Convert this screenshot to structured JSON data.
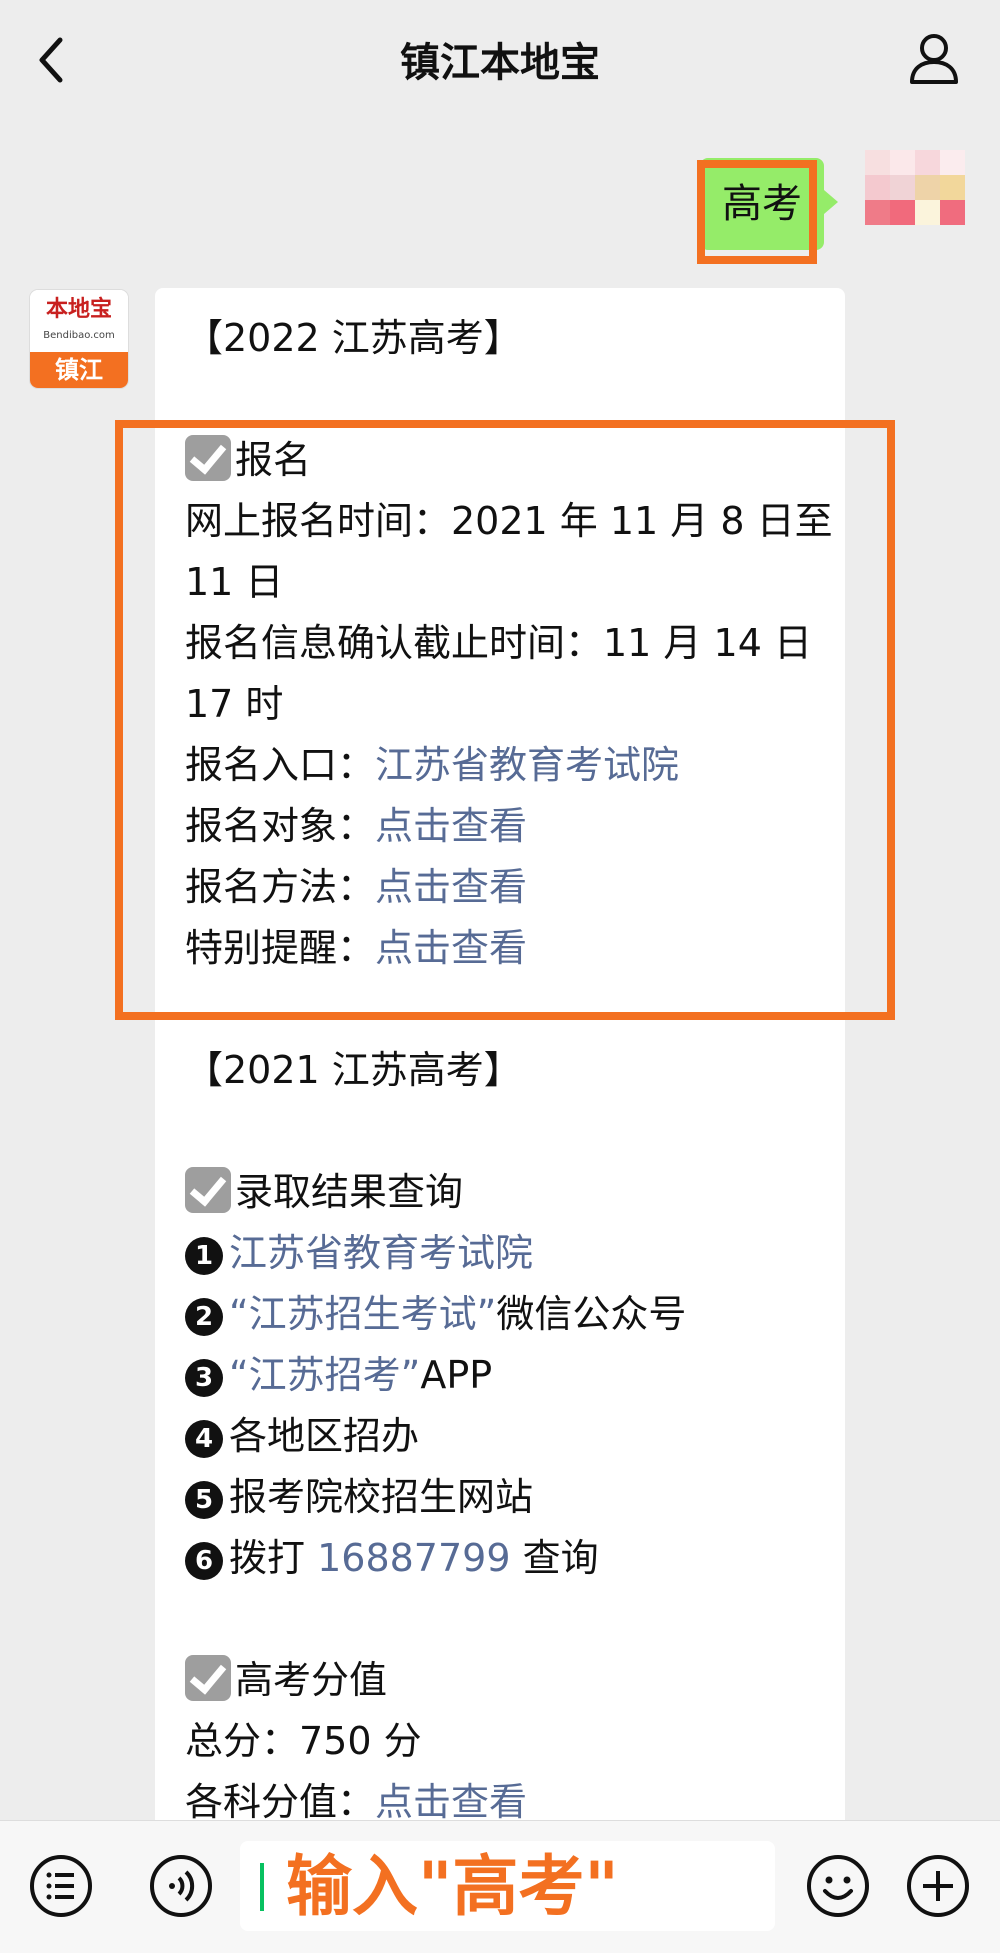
{
  "header": {
    "title": "镇江本地宝"
  },
  "outgoing_message": {
    "text": "高考"
  },
  "bot_avatar": {
    "brand": "本地宝",
    "brand_sub": "Bendibao.com",
    "city": "镇江"
  },
  "reply": {
    "section_2022": {
      "heading": "【2022 江苏高考】",
      "registration_title": "报名",
      "online_time_line1": "网上报名时间：2021 年 11 月 8 日至",
      "online_time_line2": "11 日",
      "confirm_line1": "报名信息确认截止时间：11 月 14 日",
      "confirm_line2": "17 时",
      "entry_label": "报名入口：",
      "entry_link": "江苏省教育考试院",
      "target_label": "报名对象：",
      "target_link": "点击查看",
      "method_label": "报名方法：",
      "method_link": "点击查看",
      "reminder_label": "特别提醒：",
      "reminder_link": "点击查看"
    },
    "section_2021": {
      "heading": "【2021 江苏高考】",
      "admission_title": "录取结果查询",
      "items": [
        {
          "num": "1",
          "link": "江苏省教育考试院",
          "text": ""
        },
        {
          "num": "2",
          "link": "“江苏招生考试”",
          "text": "微信公众号"
        },
        {
          "num": "3",
          "link": "“江苏招考”",
          "text": "APP"
        },
        {
          "num": "4",
          "link": "",
          "text": "各地区招办"
        },
        {
          "num": "5",
          "link": "",
          "text": "报考院校招生网站"
        },
        {
          "num": "6",
          "prefix": "拨打 ",
          "link": "16887799",
          "text": " 查询"
        }
      ],
      "score_title": "高考分值",
      "total_line": "总分：750 分",
      "subject_label": "各科分值：",
      "subject_link": "点击查看"
    }
  },
  "composer": {
    "input_value": "输入\"高考\""
  },
  "icons": {
    "back": "chevron-left-icon",
    "profile": "person-icon",
    "menu": "list-icon",
    "voice": "voice-icon",
    "emoji": "emoji-icon",
    "add": "plus-icon"
  },
  "colors": {
    "highlight": "#f37021",
    "bubble_out": "#95ec69",
    "link": "#576b95"
  }
}
